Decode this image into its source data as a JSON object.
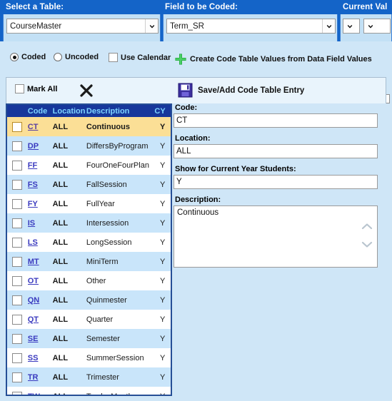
{
  "header": {
    "select_table_label": "Select a Table:",
    "field_to_be_coded_label": "Field to be Coded:",
    "current_value_label": "Current Val",
    "table_value": "CourseMaster",
    "field_value": "Term_SR"
  },
  "options": {
    "coded_label": "Coded",
    "uncoded_label": "Uncoded",
    "use_calendar_label": "Use Calendar",
    "create_values_label": "Create Code Table Values from Data Field Values"
  },
  "toolbar": {
    "mark_all_label": "Mark All",
    "save_label": "Save/Add Code Table Entry"
  },
  "table": {
    "columns": [
      "",
      "Code",
      "Location",
      "Description",
      "CY"
    ],
    "rows": [
      {
        "code": "CT",
        "location": "ALL",
        "description": "Continuous",
        "cy": "Y"
      },
      {
        "code": "DP",
        "location": "ALL",
        "description": "DiffersByProgram",
        "cy": "Y"
      },
      {
        "code": "FF",
        "location": "ALL",
        "description": "FourOneFourPlan",
        "cy": "Y"
      },
      {
        "code": "FS",
        "location": "ALL",
        "description": "FallSession",
        "cy": "Y"
      },
      {
        "code": "FY",
        "location": "ALL",
        "description": "FullYear",
        "cy": "Y"
      },
      {
        "code": "IS",
        "location": "ALL",
        "description": "Intersession",
        "cy": "Y"
      },
      {
        "code": "LS",
        "location": "ALL",
        "description": "LongSession",
        "cy": "Y"
      },
      {
        "code": "MT",
        "location": "ALL",
        "description": "MiniTerm",
        "cy": "Y"
      },
      {
        "code": "OT",
        "location": "ALL",
        "description": "Other",
        "cy": "Y"
      },
      {
        "code": "QN",
        "location": "ALL",
        "description": "Quinmester",
        "cy": "Y"
      },
      {
        "code": "QT",
        "location": "ALL",
        "description": "Quarter",
        "cy": "Y"
      },
      {
        "code": "SE",
        "location": "ALL",
        "description": "Semester",
        "cy": "Y"
      },
      {
        "code": "SS",
        "location": "ALL",
        "description": "SummerSession",
        "cy": "Y"
      },
      {
        "code": "TR",
        "location": "ALL",
        "description": "Trimester",
        "cy": "Y"
      },
      {
        "code": "TW",
        "location": "ALL",
        "description": "TwelveMonth",
        "cy": "Y"
      }
    ],
    "selected_index": 0
  },
  "form": {
    "code_label": "Code:",
    "code_value": "CT",
    "location_label": "Location:",
    "location_value": "ALL",
    "show_current_label": "Show for Current Year Students:",
    "show_current_value": "Y",
    "description_label": "Description:",
    "description_value": "Continuous"
  },
  "colors": {
    "header_blue": "#1464c8",
    "panel_blue": "#cfe6f7",
    "grid_header": "#17379b",
    "grid_header_text": "#7fd4ff",
    "row_alt": "#c9e5fa",
    "row_selected": "#fbdf96",
    "link": "#3a3abf",
    "plus_green": "#16a02c"
  }
}
